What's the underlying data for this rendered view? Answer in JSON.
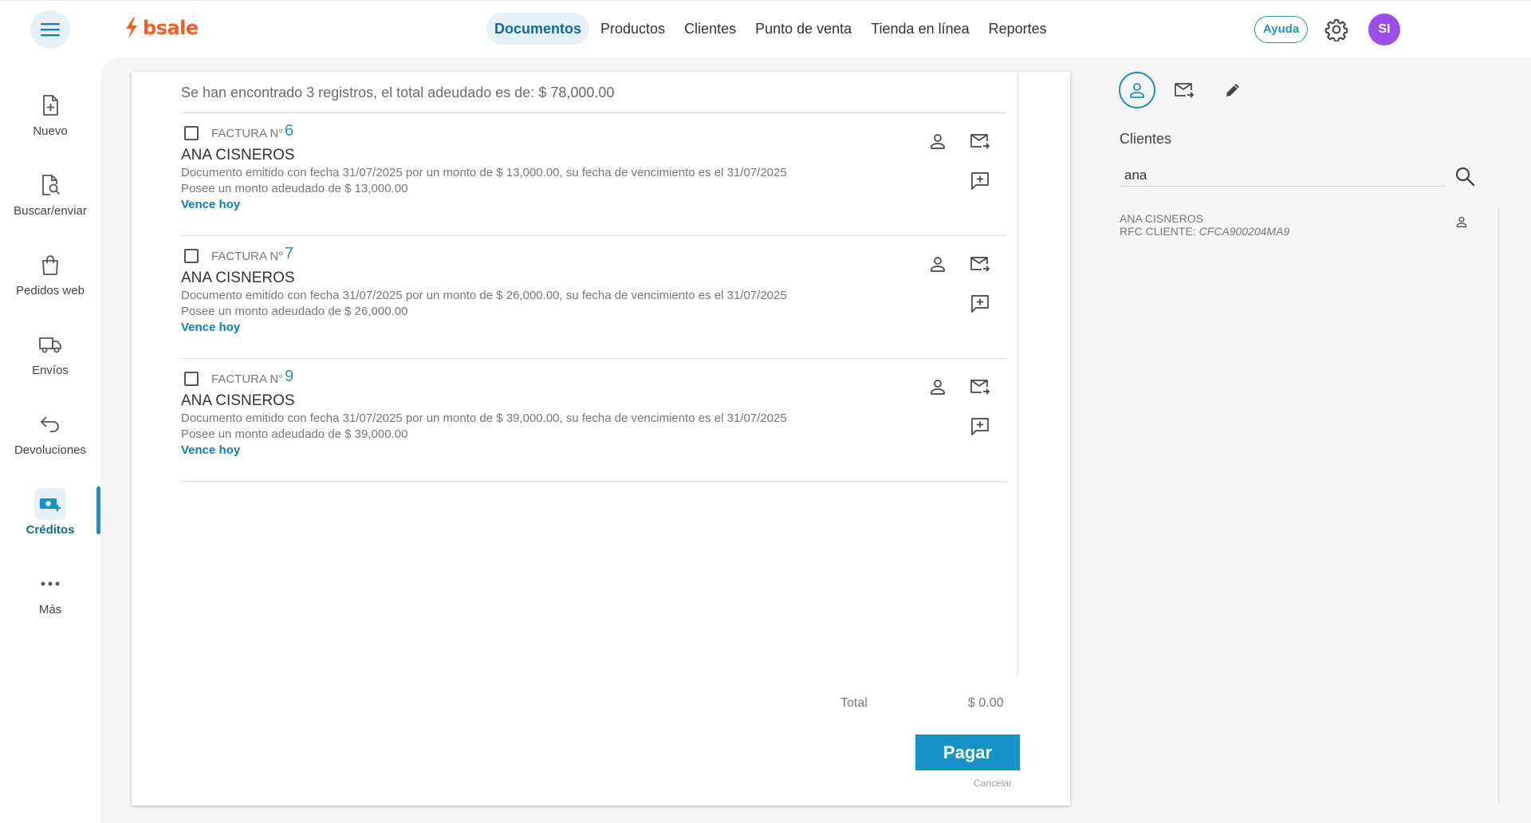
{
  "header": {
    "menu_icon": "hamburger-icon",
    "logo_text": "bsale",
    "nav": [
      {
        "label": "Documentos",
        "active": true
      },
      {
        "label": "Productos",
        "active": false
      },
      {
        "label": "Clientes",
        "active": false
      },
      {
        "label": "Punto de venta",
        "active": false
      },
      {
        "label": "Tienda en línea",
        "active": false
      },
      {
        "label": "Reportes",
        "active": false
      }
    ],
    "help_label": "Ayuda",
    "avatar_initials": "SI",
    "avatar_color": "#9b4de8"
  },
  "sidebar": {
    "items": [
      {
        "label": "Nuevo",
        "icon": "new-document-icon"
      },
      {
        "label": "Buscar/enviar",
        "icon": "search-document-icon"
      },
      {
        "label": "Pedidos web",
        "icon": "shopping-bag-icon"
      },
      {
        "label": "Envíos",
        "icon": "truck-icon"
      },
      {
        "label": "Devoluciones",
        "icon": "return-arrow-icon"
      },
      {
        "label": "Créditos",
        "icon": "credit-money-icon",
        "active": true
      },
      {
        "label": "Más",
        "icon": "more-dots-icon"
      }
    ]
  },
  "main": {
    "summary": "Se han encontrado 3 registros, el total adeudado es de: $ 78,000.00",
    "documents": [
      {
        "type": "FACTURA N°",
        "number": "6",
        "client": "ANA CISNEROS",
        "description": "Documento emitido con fecha 31/07/2025 por un monto de $ 13,000.00, su fecha de vencimiento es el 31/07/2025",
        "owed": "Posee un monto adeudado de $ 13,000.00",
        "due": "Vence hoy"
      },
      {
        "type": "FACTURA N°",
        "number": "7",
        "client": "ANA CISNEROS",
        "description": "Documento emitido con fecha 31/07/2025 por un monto de $ 26,000.00, su fecha de vencimiento es el 31/07/2025",
        "owed": "Posee un monto adeudado de $ 26,000.00",
        "due": "Vence hoy"
      },
      {
        "type": "FACTURA N°",
        "number": "9",
        "client": "ANA CISNEROS",
        "description": "Documento emitido con fecha 31/07/2025 por un monto de $ 39,000.00, su fecha de vencimiento es el 31/07/2025",
        "owed": "Posee un monto adeudado de $ 39,000.00",
        "due": "Vence hoy"
      }
    ],
    "total_label": "Total",
    "total_value": "$ 0.00",
    "pay_label": "Pagar",
    "cancel_label": "Cancelar"
  },
  "right_panel": {
    "tabs": [
      "client-icon",
      "email-forward-icon",
      "pencil-icon"
    ],
    "title": "Clientes",
    "search_value": "ana",
    "results": [
      {
        "name": "ANA CISNEROS",
        "rfc_label": "RFC CLIENTE:",
        "rfc_value": "CFCA900204MA9"
      }
    ]
  },
  "colors": {
    "accent": "#1593c8",
    "brand": "#ff5a1f",
    "active_bg": "#e4f1f8"
  }
}
